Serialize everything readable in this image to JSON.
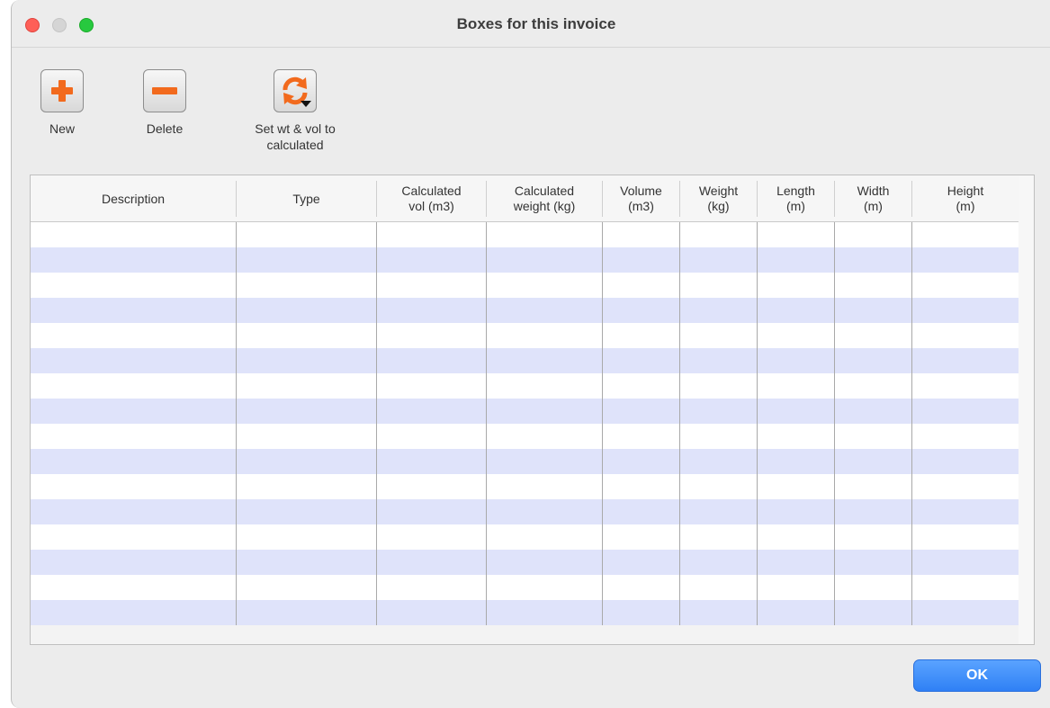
{
  "window": {
    "title": "Boxes for this invoice"
  },
  "toolbar": {
    "new_label": "New",
    "delete_label": "Delete",
    "set_label": "Set wt & vol to\ncalculated"
  },
  "table": {
    "columns": [
      "Description",
      "Type",
      "Calculated\nvol (m3)",
      "Calculated\nweight (kg)",
      "Volume\n(m3)",
      "Weight\n(kg)",
      "Length\n(m)",
      "Width\n(m)",
      "Height\n(m)"
    ],
    "rows": []
  },
  "footer": {
    "ok_label": "OK"
  },
  "colors": {
    "accent": "#2f80f5",
    "row_stripe": "#dfe3fa",
    "icon_orange": "#f26a1d"
  },
  "icons": [
    "plus-icon",
    "minus-icon",
    "refresh-icon"
  ]
}
